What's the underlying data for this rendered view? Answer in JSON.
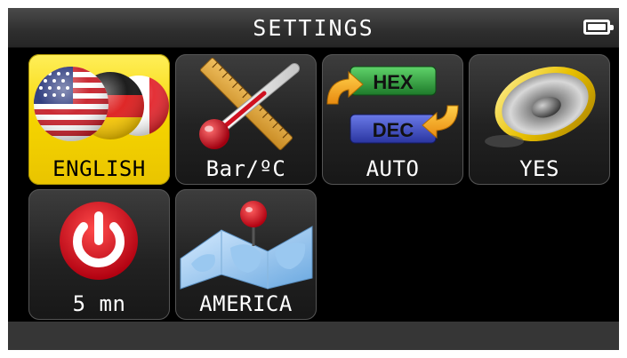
{
  "header": {
    "title": "SETTINGS",
    "battery_icon": "battery-full-icon"
  },
  "tiles": [
    {
      "label": "ENGLISH",
      "icon": "language-flags-icon",
      "selected": true
    },
    {
      "label": "Bar/ºC",
      "icon": "units-ruler-thermometer-icon",
      "selected": false
    },
    {
      "label": "AUTO",
      "icon": "hex-dec-toggle-icon",
      "selected": false
    },
    {
      "label": "YES",
      "icon": "speaker-icon",
      "selected": false
    },
    {
      "label": "5 mn",
      "icon": "power-icon",
      "selected": false
    },
    {
      "label": "AMERICA",
      "icon": "map-pin-icon",
      "selected": false
    }
  ],
  "icon_text": {
    "hex": "HEX",
    "dec": "DEC"
  },
  "colors": {
    "selected_tile": "#f5d400",
    "background": "#000000",
    "power_red": "#e02020"
  }
}
